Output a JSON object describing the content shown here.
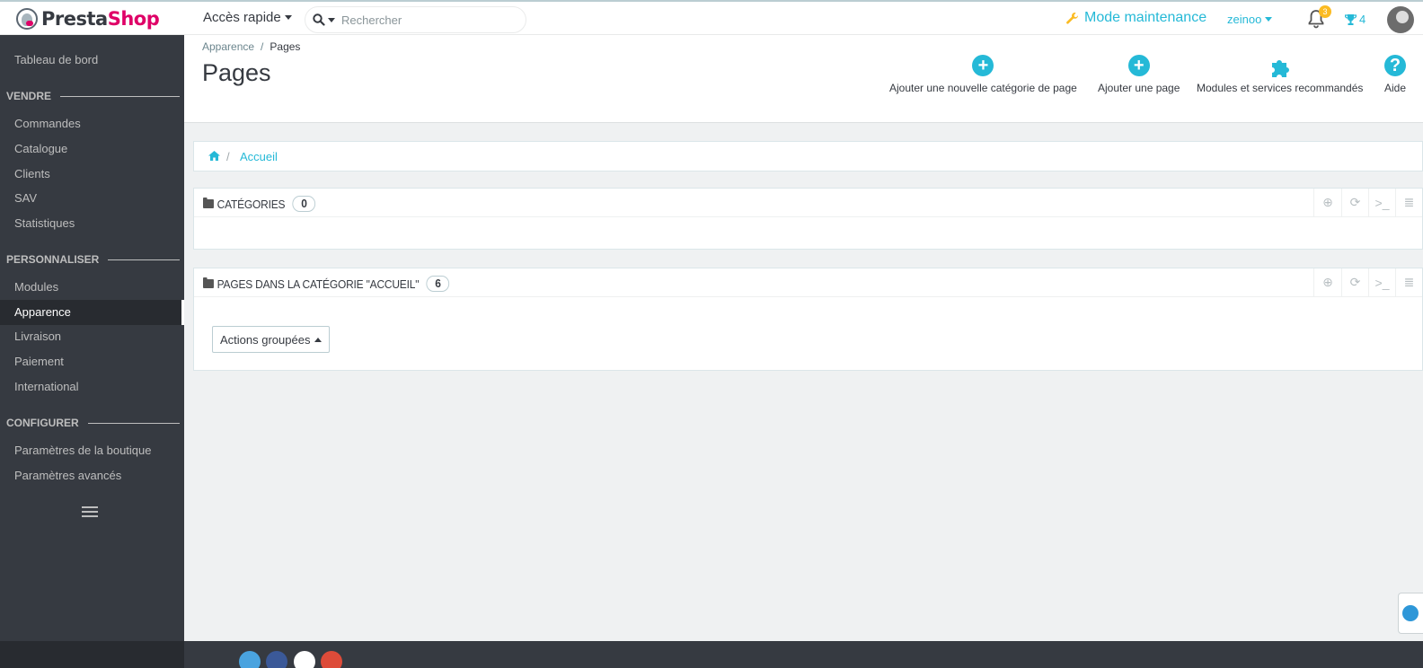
{
  "header": {
    "logo_text_a": "Presta",
    "logo_text_b": "Shop",
    "quick_access": "Accès rapide",
    "search_placeholder": "Rechercher",
    "maintenance": "Mode maintenance",
    "user": "zeinoo",
    "notifications_count": "3",
    "trophy_count": "4"
  },
  "sidebar": {
    "dashboard": "Tableau de bord",
    "sections": [
      {
        "title": "VENDRE",
        "items": [
          "Commandes",
          "Catalogue",
          "Clients",
          "SAV",
          "Statistiques"
        ]
      },
      {
        "title": "PERSONNALISER",
        "items": [
          "Modules",
          "Apparence",
          "Livraison",
          "Paiement",
          "International"
        ]
      },
      {
        "title": "CONFIGURER",
        "items": [
          "Paramètres de la boutique",
          "Paramètres avancés"
        ]
      }
    ],
    "active_item": "Apparence"
  },
  "page": {
    "breadcrumb": [
      "Apparence",
      "Pages"
    ],
    "title": "Pages",
    "toolbar": [
      "Ajouter une nouvelle catégorie de page",
      "Ajouter une page",
      "Modules et services recommandés",
      "Aide"
    ]
  },
  "content": {
    "breadcrumb_home": "Accueil",
    "categories_title": "CATÉGORIES",
    "categories_count": "0",
    "pages_title": "PAGES DANS LA CATÉGORIE \"ACCUEIL\"",
    "pages_count": "6",
    "bulk_actions": "Actions groupées"
  },
  "colors": {
    "accent": "#25b9d7",
    "brand": "#df0067",
    "sidebar": "#363a41"
  }
}
